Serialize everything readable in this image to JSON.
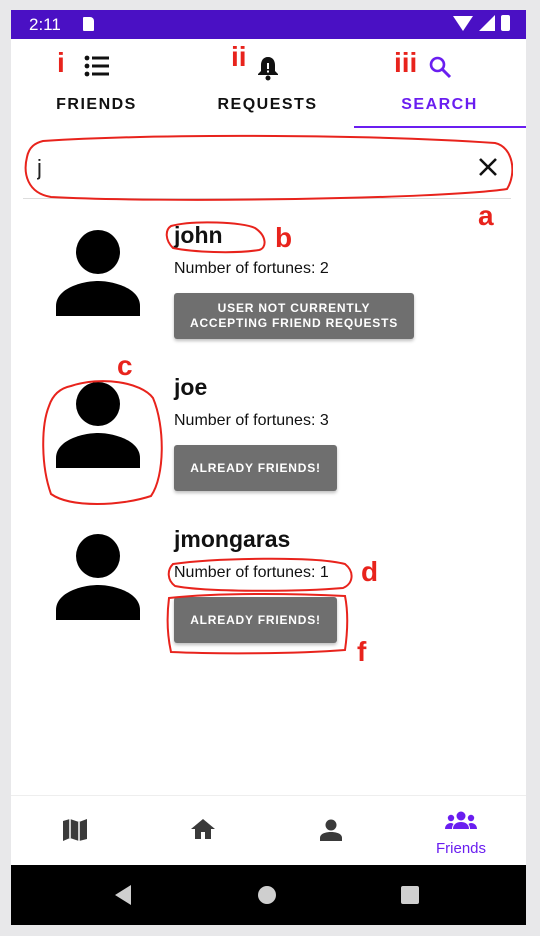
{
  "status_bar": {
    "time": "2:11"
  },
  "tabs": [
    {
      "label": "FRIENDS",
      "icon": "list-icon",
      "annotation": "i"
    },
    {
      "label": "REQUESTS",
      "icon": "bell-icon",
      "annotation": "ii"
    },
    {
      "label": "SEARCH",
      "icon": "search-icon",
      "annotation": "iii",
      "active": true
    }
  ],
  "search": {
    "value": "j",
    "annotation": "a"
  },
  "users": [
    {
      "name": "john",
      "fortunes": "Number of fortunes: 2",
      "button": "USER NOT CURRENTLY\nACCEPTING FRIEND REQUESTS"
    },
    {
      "name": "joe",
      "fortunes": "Number of fortunes: 3",
      "button": "ALREADY FRIENDS!"
    },
    {
      "name": "jmongaras",
      "fortunes": "Number of fortunes: 1",
      "button": "ALREADY FRIENDS!"
    }
  ],
  "annotations": {
    "b": "b",
    "c": "c",
    "d": "d",
    "f": "f"
  },
  "bottom_nav": [
    {
      "icon": "map-icon",
      "label": ""
    },
    {
      "icon": "home-icon",
      "label": ""
    },
    {
      "icon": "person-icon",
      "label": ""
    },
    {
      "icon": "group-icon",
      "label": "Friends",
      "active": true
    }
  ],
  "colors": {
    "accent": "#6a1ef0",
    "status_bar": "#4a10c4",
    "button": "#6f6f6f",
    "annotation": "#e8231c"
  }
}
